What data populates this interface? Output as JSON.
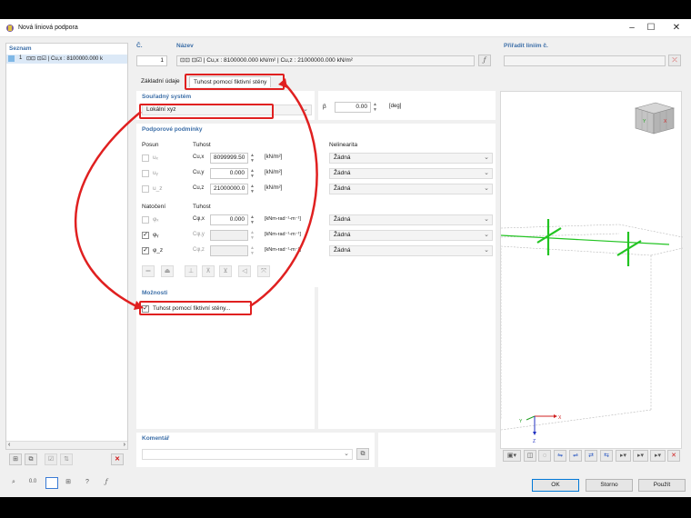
{
  "window": {
    "title": "Nová liniová podpora"
  },
  "list": {
    "header": "Seznam",
    "item_number": "1",
    "item_text": "⊡⊡ ⊡☑ | Cu,x : 8100000.000 k"
  },
  "number": {
    "label": "Č.",
    "value": "1"
  },
  "name": {
    "label": "Název",
    "value": "⊡⊡ ⊡☑ | Cu,x : 8100000.000 kN/m² | Cu,z : 21000000.000 kN/m²"
  },
  "assign": {
    "label": "Přiřadit liniím č."
  },
  "tabs": [
    {
      "label": "Základní údaje"
    },
    {
      "label": "Tuhost pomocí fiktivní stěny"
    }
  ],
  "coordsys": {
    "header": "Souřadný systém",
    "value": "Lokální xyz",
    "beta_symbol": "β",
    "beta_value": "0.00",
    "beta_unit": "[deg]"
  },
  "support": {
    "header": "Podporové podmínky",
    "posun_label": "Posun",
    "tuhost_label": "Tuhost",
    "nelinearita_label": "Nelinearita",
    "natoceni_label": "Natočení",
    "tuhost2_label": "Tuhost",
    "translations": [
      {
        "sym": "uₓ",
        "c": "Cu,x",
        "value": "8099999.50",
        "unit": "[kN/m²]",
        "nonlin": "Žádná",
        "checked": false
      },
      {
        "sym": "uᵧ",
        "c": "Cu,y",
        "value": "0.000",
        "unit": "[kN/m²]",
        "nonlin": "Žádná",
        "checked": false
      },
      {
        "sym": "u_z",
        "c": "Cu,z",
        "value": "21000000.0",
        "unit": "[kN/m²]",
        "nonlin": "Žádná",
        "checked": false
      }
    ],
    "rotations": [
      {
        "sym": "φₓ",
        "c": "Cφ,x",
        "value": "0.000",
        "unit": "[kNm-rad⁻¹-m⁻¹]",
        "nonlin": "Žádná",
        "checked": false
      },
      {
        "sym": "φᵧ",
        "c": "Cφ,y",
        "value": "",
        "unit": "[kNm-rad⁻¹-m⁻¹]",
        "nonlin": "Žádná",
        "checked": true
      },
      {
        "sym": "φ_z",
        "c": "Cφ,z",
        "value": "",
        "unit": "[kNm-rad⁻¹-m⁻¹]",
        "nonlin": "Žádná",
        "checked": true
      }
    ]
  },
  "options": {
    "header": "Možnosti",
    "checkbox_label": "Tuhost pomocí fiktivní stěny..."
  },
  "comment": {
    "header": "Komentář"
  },
  "buttons": {
    "ok": "OK",
    "cancel": "Storno",
    "apply": "Použít"
  },
  "axes": {
    "x": "X",
    "y": "Y",
    "z": "Z"
  },
  "colors": {
    "highlight_red": "#e02020",
    "header_blue": "#3d6fa8",
    "support_green": "#22c422"
  }
}
